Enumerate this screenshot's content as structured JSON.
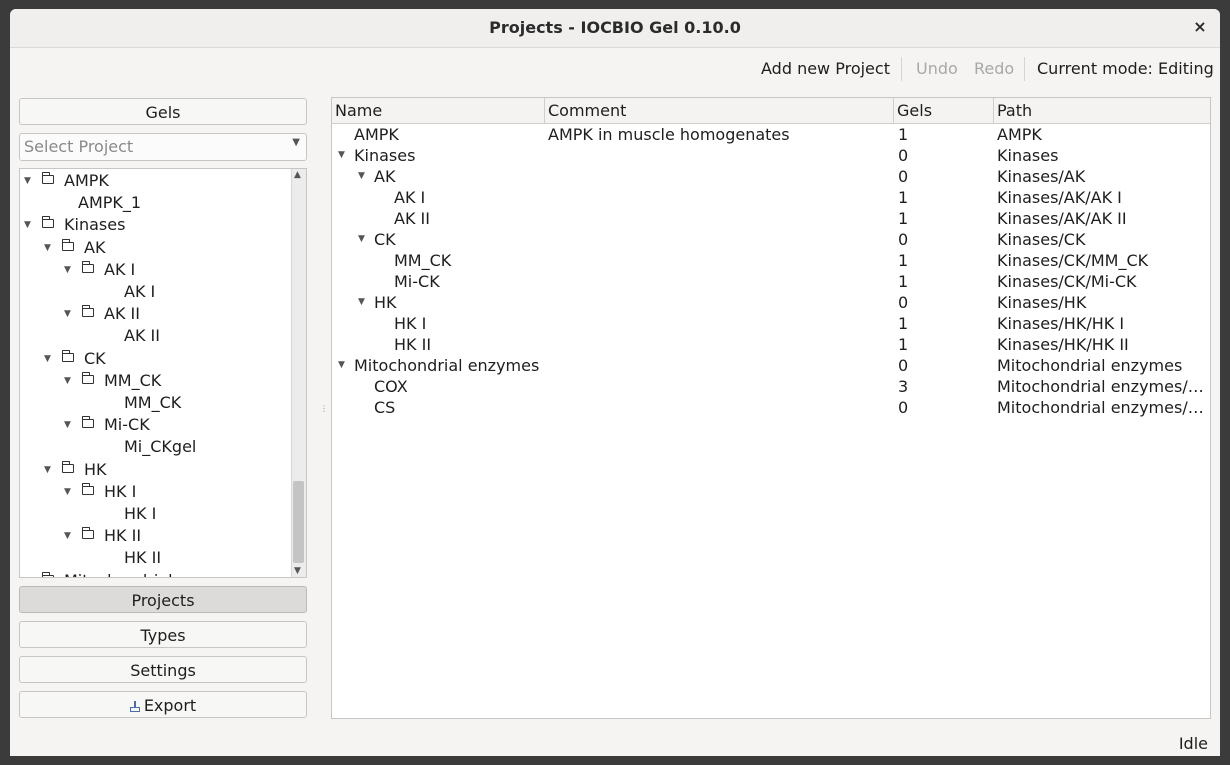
{
  "window": {
    "title": "Projects - IOCBIO Gel 0.10.0",
    "close_glyph": "×"
  },
  "toolbar": {
    "add_project": "Add new Project",
    "undo": "Undo",
    "redo": "Redo",
    "mode": "Current mode: Editing"
  },
  "left_panel": {
    "gels_button": "Gels",
    "project_select": {
      "placeholder": "Select Project"
    },
    "tree": [
      {
        "label": "AMPK",
        "level": 0,
        "folder": true,
        "expanded": true
      },
      {
        "label": "AMPK_1",
        "level": 1,
        "folder": false
      },
      {
        "label": "Kinases",
        "level": 0,
        "folder": true,
        "expanded": true
      },
      {
        "label": "AK",
        "level": 1,
        "folder": true,
        "expanded": true
      },
      {
        "label": "AK I",
        "level": 2,
        "folder": true,
        "expanded": true
      },
      {
        "label": "AK I",
        "level": 3,
        "folder": false
      },
      {
        "label": "AK II",
        "level": 2,
        "folder": true,
        "expanded": true
      },
      {
        "label": "AK II",
        "level": 3,
        "folder": false
      },
      {
        "label": "CK",
        "level": 1,
        "folder": true,
        "expanded": true
      },
      {
        "label": "MM_CK",
        "level": 2,
        "folder": true,
        "expanded": true
      },
      {
        "label": "MM_CK",
        "level": 3,
        "folder": false
      },
      {
        "label": "Mi-CK",
        "level": 2,
        "folder": true,
        "expanded": true
      },
      {
        "label": "Mi_CKgel",
        "level": 3,
        "folder": false
      },
      {
        "label": "HK",
        "level": 1,
        "folder": true,
        "expanded": true
      },
      {
        "label": "HK I",
        "level": 2,
        "folder": true,
        "expanded": true
      },
      {
        "label": "HK I",
        "level": 3,
        "folder": false
      },
      {
        "label": "HK II",
        "level": 2,
        "folder": true,
        "expanded": true
      },
      {
        "label": "HK II",
        "level": 3,
        "folder": false
      },
      {
        "label": "Mitochondrial enzymes",
        "level": 0,
        "folder": true,
        "expanded": true
      }
    ],
    "nav": {
      "projects": "Projects",
      "types": "Types",
      "settings": "Settings",
      "export": "Export"
    }
  },
  "table": {
    "columns": [
      "Name",
      "Comment",
      "Gels",
      "Path"
    ],
    "rows": [
      {
        "name": "AMPK",
        "level": 0,
        "expander": false,
        "comment": "AMPK in muscle homogenates",
        "gels": "1",
        "path": "AMPK"
      },
      {
        "name": "Kinases",
        "level": 0,
        "expander": true,
        "comment": "",
        "gels": "0",
        "path": "Kinases"
      },
      {
        "name": "AK",
        "level": 1,
        "expander": true,
        "comment": "",
        "gels": "0",
        "path": "Kinases/AK"
      },
      {
        "name": "AK I",
        "level": 2,
        "expander": false,
        "comment": "",
        "gels": "1",
        "path": "Kinases/AK/AK I"
      },
      {
        "name": "AK II",
        "level": 2,
        "expander": false,
        "comment": "",
        "gels": "1",
        "path": "Kinases/AK/AK II"
      },
      {
        "name": "CK",
        "level": 1,
        "expander": true,
        "comment": "",
        "gels": "0",
        "path": "Kinases/CK"
      },
      {
        "name": "MM_CK",
        "level": 2,
        "expander": false,
        "comment": "",
        "gels": "1",
        "path": "Kinases/CK/MM_CK"
      },
      {
        "name": "Mi-CK",
        "level": 2,
        "expander": false,
        "comment": "",
        "gels": "1",
        "path": "Kinases/CK/Mi-CK"
      },
      {
        "name": "HK",
        "level": 1,
        "expander": true,
        "comment": "",
        "gels": "0",
        "path": "Kinases/HK"
      },
      {
        "name": "HK I",
        "level": 2,
        "expander": false,
        "comment": "",
        "gels": "1",
        "path": "Kinases/HK/HK I"
      },
      {
        "name": "HK II",
        "level": 2,
        "expander": false,
        "comment": "",
        "gels": "1",
        "path": "Kinases/HK/HK II"
      },
      {
        "name": "Mitochondrial enzymes",
        "level": 0,
        "expander": true,
        "comment": "",
        "gels": "0",
        "path": "Mitochondrial enzymes"
      },
      {
        "name": "COX",
        "level": 1,
        "expander": false,
        "comment": "",
        "gels": "3",
        "path": "Mitochondrial enzymes/C…"
      },
      {
        "name": "CS",
        "level": 1,
        "expander": false,
        "comment": "",
        "gels": "0",
        "path": "Mitochondrial enzymes/CS"
      }
    ]
  },
  "status": {
    "text": "Idle"
  }
}
